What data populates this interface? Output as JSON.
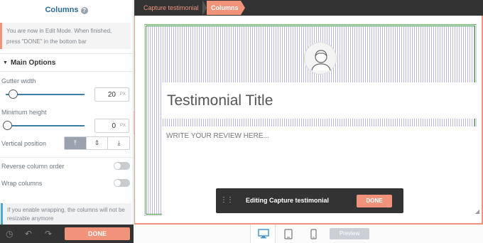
{
  "panel": {
    "title": "Columns",
    "help_icon": "?",
    "notice": "You are now in Edit Mode. When finished, press \"DONE\" in the bottom bar",
    "section_title": "Main Options",
    "gutter_label": "Gutter width",
    "gutter_value": "20",
    "gutter_unit": "PX",
    "gutter_level": 0.08,
    "min_height_label": "Minimum height",
    "min_height_value": "0",
    "min_height_unit": "PX",
    "min_height_level": 0.0,
    "vpos_label": "Vertical position",
    "vpos_options": [
      "top",
      "middle",
      "bottom"
    ],
    "vpos_selected": "top",
    "reverse_label": "Reverse column order",
    "reverse_on": false,
    "wrap_label": "Wrap columns",
    "wrap_on": false,
    "wrap_note": "If you enable wrapping, the columns will not be resizable anymore",
    "done_label": "DONE"
  },
  "breadcrumb": [
    "Capture testimonial",
    "Columns"
  ],
  "canvas": {
    "title_text": "Testimonial Title",
    "review_placeholder": "WRITE YOUR REVIEW HERE..."
  },
  "edit_bar": {
    "label": "Editing Capture testimonial",
    "done_label": "DONE"
  },
  "device_bar": {
    "devices": [
      "desktop-icon",
      "tablet-icon",
      "mobile-icon"
    ],
    "active_device": "desktop",
    "preview_label": "Preview"
  },
  "colors": {
    "accent": "#f0937a",
    "dark": "#333333",
    "link": "#2c6c99",
    "column_stripes": "#b9b6e8",
    "column_border": "#3d9b45"
  }
}
